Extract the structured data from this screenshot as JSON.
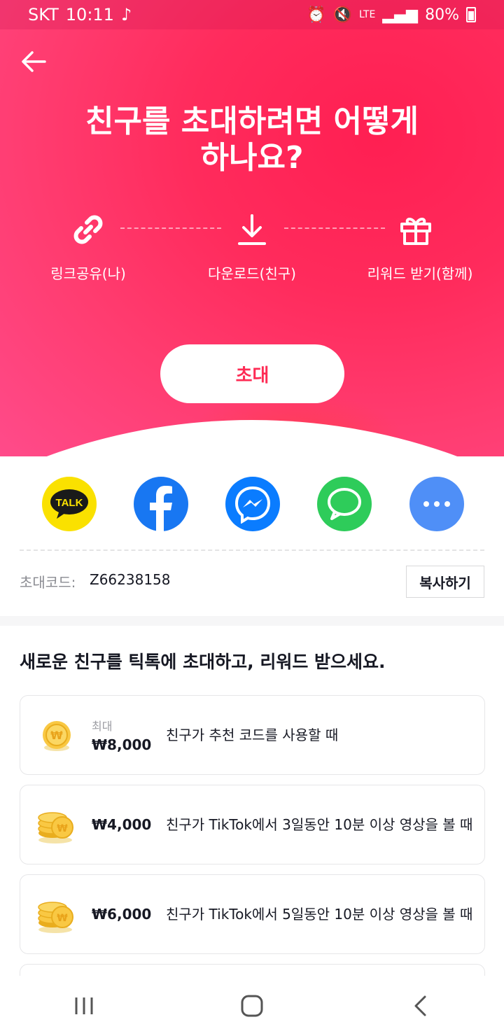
{
  "status_bar": {
    "carrier": "SKT",
    "time": "10:11",
    "network": "LTE",
    "battery": "80%"
  },
  "hero": {
    "title_line1": "친구를 초대하려면 어떻게",
    "title_line2": "하나요?",
    "steps": [
      {
        "icon": "link-icon",
        "label": "링크공유(나)"
      },
      {
        "icon": "download-icon",
        "label": "다운로드(친구)"
      },
      {
        "icon": "gift-icon",
        "label": "리워드 받기(함께)"
      }
    ],
    "invite_label": "초대"
  },
  "share": {
    "kakao_text": "TALK",
    "items": [
      "kakaotalk",
      "facebook",
      "messenger",
      "messages",
      "more"
    ]
  },
  "invite_code": {
    "label": "초대코드:",
    "value": "Z66238158",
    "copy_label": "복사하기"
  },
  "rewards": {
    "title": "새로운 친구를 틱톡에 초대하고, 리워드 받으세요.",
    "items": [
      {
        "max_label": "최대",
        "amount": "₩8,000",
        "desc": "친구가 추천 코드를 사용할 때"
      },
      {
        "max_label": "",
        "amount": "₩4,000",
        "desc": "친구가 TikTok에서 3일동안 10분 이상 영상을 볼 때"
      },
      {
        "max_label": "",
        "amount": "₩6,000",
        "desc": "친구가 TikTok에서 5일동안 10분 이상 영상을 볼 때"
      }
    ]
  },
  "colors": {
    "brand": "#fe2c55",
    "kakao": "#fae100",
    "facebook": "#1877f2",
    "messenger": "#0a7cff",
    "messages": "#2ecc5a",
    "more": "#4f8ff7"
  }
}
